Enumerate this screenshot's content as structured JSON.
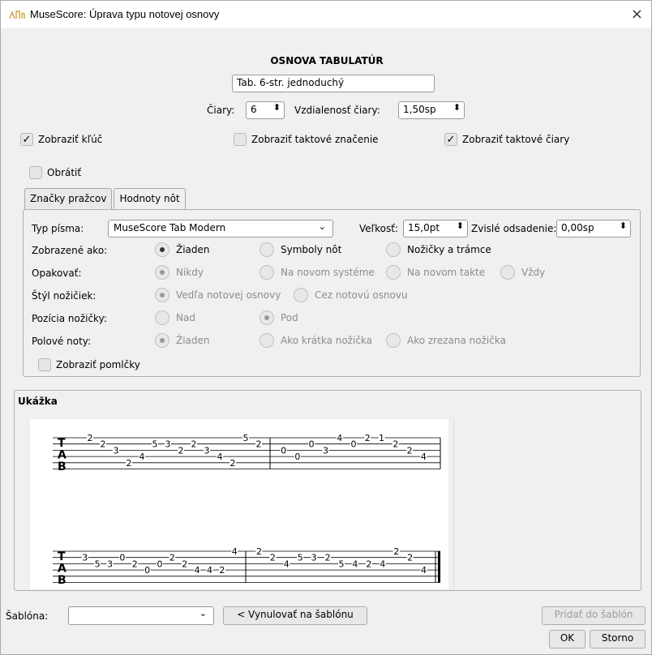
{
  "window": {
    "title": "MuseScore: Úprava typu notovej osnovy",
    "close": "×"
  },
  "header": "OSNOVA TABULATÚR",
  "staff_name": "Tab. 6-str. jednoduchý",
  "lines_label": "Čiary:",
  "lines_value": "6",
  "line_distance_label": "Vzdialenosť čiary:",
  "line_distance_value": "1,50sp",
  "show_clef": {
    "label": "Zobraziť kľúč",
    "checked": true
  },
  "show_timesig": {
    "label": "Zobraziť taktové značenie",
    "checked": false
  },
  "show_barlines": {
    "label": "Zobraziť taktové čiary",
    "checked": true
  },
  "flip": {
    "label": "Obrátiť",
    "checked": false
  },
  "tabs": [
    "Značky pražcov",
    "Hodnoty nôt"
  ],
  "active_tab": "Hodnoty nôt",
  "font_type_label": "Typ písma:",
  "font_type_value": "MuseScore Tab Modern",
  "size_label": "Veľkosť:",
  "size_value": "15,0pt",
  "vertical_offset_label": "Zvislé odsadenie:",
  "vertical_offset_value": "0,00sp",
  "rows": [
    {
      "label": "Zobrazené ako:",
      "options": [
        "Žiaden",
        "Symboly nôt",
        "Nožičky a trámce"
      ],
      "selected": 0,
      "disabled": false
    },
    {
      "label": "Opakovať:",
      "options": [
        "Nikdy",
        "Na novom systéme",
        "Na novom takte",
        "Vždy"
      ],
      "selected": 0,
      "disabled": true
    },
    {
      "label": "Štýl nožičiek:",
      "options": [
        "Vedľa notovej osnovy",
        "Cez notovú osnovu"
      ],
      "selected": 0,
      "disabled": true
    },
    {
      "label": "Pozícia nožičky:",
      "options": [
        "Nad",
        "Pod"
      ],
      "selected": 1,
      "disabled": true
    },
    {
      "label": "Polové noty:",
      "options": [
        "Žiaden",
        "Ako krátka nožička",
        "Ako zrezana nožička"
      ],
      "selected": 0,
      "disabled": true
    }
  ],
  "show_rests": {
    "label": "Zobraziť pomlčky",
    "checked": false
  },
  "preview_title": "Ukážka",
  "template_label": "Šablóna:",
  "template_value": "",
  "reset_button": "< Vynulovať na šablónu",
  "add_template_button": "Pridať do šablón",
  "ok_button": "OK",
  "cancel_button": "Storno",
  "clef_letters": [
    "T",
    "A",
    "B"
  ],
  "tab_system1": {
    "measure1": [
      {
        "string": 1,
        "fret": "2"
      },
      {
        "string": 2,
        "fret": "2"
      },
      {
        "string": 3,
        "fret": "3"
      },
      {
        "string": 5,
        "fret": "2"
      },
      {
        "string": 4,
        "fret": "4"
      },
      {
        "string": 2,
        "fret": "5"
      },
      {
        "string": 2,
        "fret": "3"
      },
      {
        "string": 3,
        "fret": "2"
      },
      {
        "string": 2,
        "fret": "2"
      },
      {
        "string": 3,
        "fret": "3"
      },
      {
        "string": 4,
        "fret": "4"
      },
      {
        "string": 5,
        "fret": "2"
      },
      {
        "string": 1,
        "fret": "5"
      },
      {
        "string": 2,
        "fret": "2"
      }
    ],
    "measure2": [
      {
        "string": 3,
        "fret": "0"
      },
      {
        "string": 4,
        "fret": "0"
      },
      {
        "string": 2,
        "fret": "0"
      },
      {
        "string": 3,
        "fret": "3"
      },
      {
        "string": 1,
        "fret": "4"
      },
      {
        "string": 2,
        "fret": "0"
      },
      {
        "string": 1,
        "fret": "2"
      },
      {
        "string": 1,
        "fret": "1"
      },
      {
        "string": 2,
        "fret": "2"
      },
      {
        "string": 3,
        "fret": "2"
      },
      {
        "string": 4,
        "fret": "4"
      }
    ]
  },
  "tab_system2": {
    "measure1": [
      {
        "string": 2,
        "fret": "3"
      },
      {
        "string": 3,
        "fret": "5"
      },
      {
        "string": 3,
        "fret": "3"
      },
      {
        "string": 2,
        "fret": "0"
      },
      {
        "string": 3,
        "fret": "2"
      },
      {
        "string": 4,
        "fret": "0"
      },
      {
        "string": 3,
        "fret": "0"
      },
      {
        "string": 2,
        "fret": "2"
      },
      {
        "string": 3,
        "fret": "2"
      },
      {
        "string": 4,
        "fret": "4"
      },
      {
        "string": 4,
        "fret": "4"
      },
      {
        "string": 4,
        "fret": "2"
      },
      {
        "string": 1,
        "fret": "4"
      }
    ],
    "measure2": [
      {
        "string": 1,
        "fret": "2"
      },
      {
        "string": 2,
        "fret": "2"
      },
      {
        "string": 3,
        "fret": "4"
      },
      {
        "string": 2,
        "fret": "5"
      },
      {
        "string": 2,
        "fret": "3"
      },
      {
        "string": 2,
        "fret": "2"
      },
      {
        "string": 3,
        "fret": "5"
      },
      {
        "string": 3,
        "fret": "4"
      },
      {
        "string": 3,
        "fret": "2"
      },
      {
        "string": 3,
        "fret": "4"
      },
      {
        "string": 1,
        "fret": "2"
      },
      {
        "string": 2,
        "fret": "2"
      },
      {
        "string": 4,
        "fret": "4"
      }
    ]
  }
}
